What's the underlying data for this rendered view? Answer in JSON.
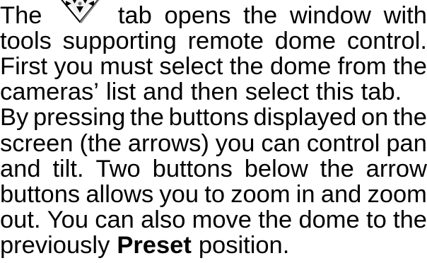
{
  "paragraph1": {
    "intro_word": "The",
    "icon": "dome-control-tab-icon",
    "line1_rest": [
      "tab",
      "opens",
      "the",
      "window",
      "with"
    ],
    "line2": [
      "tools",
      "supporting",
      "remote",
      "dome",
      "control."
    ],
    "line3": [
      "First",
      "you",
      "must",
      "select",
      "the",
      "dome",
      "from",
      "the"
    ],
    "line4": [
      "cameras’",
      "list",
      "and",
      "then",
      "select",
      "this",
      "tab."
    ]
  },
  "paragraph2": {
    "line5": [
      "By",
      "pressing",
      "the",
      "buttons",
      "displayed",
      "on",
      "the"
    ],
    "line6": [
      "screen",
      "(the",
      "arrows)",
      "you",
      "can",
      "control",
      "pan"
    ],
    "line7": [
      "and",
      "tilt.",
      "Two",
      "buttons",
      "below",
      "the",
      "arrow"
    ],
    "line8": [
      "buttons",
      "allows",
      "you",
      "to",
      "zoom",
      "in",
      "and",
      "zoom"
    ],
    "line9": [
      "out.",
      "You",
      "can",
      "also",
      "move",
      "the",
      "dome",
      "to",
      "the"
    ],
    "line10_before": "previously",
    "line10_bold": "Preset",
    "line10_after": "position."
  }
}
